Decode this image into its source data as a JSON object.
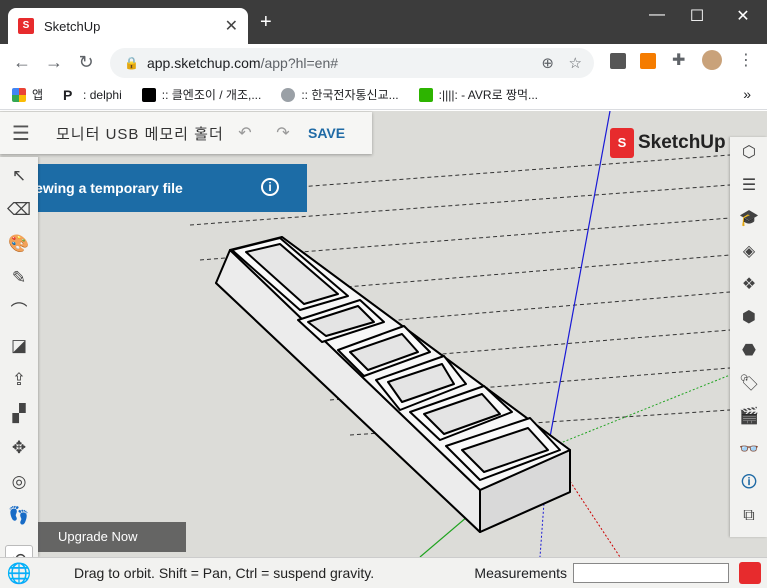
{
  "browser": {
    "tab_title": "SketchUp",
    "tab_close": "✕",
    "new_tab": "+",
    "url_host": "app.sketchup.com",
    "url_path": "/app?hl=en#",
    "window_controls": [
      "—",
      "☐",
      "✕"
    ]
  },
  "bookmarks": [
    {
      "label": "앱",
      "icon": "apps-grid-icon",
      "color": "#ea4335"
    },
    {
      "label": ": delphi",
      "icon": "p-logo-icon",
      "color": "#000000"
    },
    {
      "label": ":: 클엔조이 / 개조,...",
      "icon": "clien-icon",
      "color": "#000000"
    },
    {
      "label": ":: 한국전자통신교...",
      "icon": "globe-icon",
      "color": "#5f6368"
    },
    {
      "label": ":||||: - AVR로 짱먹...",
      "icon": "chat-icon",
      "color": "#2db400"
    }
  ],
  "bookmarks_more": "»",
  "header": {
    "menu_icon": "hamburger-icon",
    "file_name": "모니터 USB 메모리 홀더",
    "undo": "↶",
    "redo": "↷",
    "save_label": "SAVE"
  },
  "banner": {
    "text": "u are viewing a temporary file",
    "info": "i"
  },
  "logo": {
    "mark": "S",
    "name": "SketchUp"
  },
  "left_tools": [
    {
      "name": "select-tool-icon",
      "glyph": "↖",
      "selected": false
    },
    {
      "name": "eraser-tool-icon",
      "glyph": "⌫",
      "selected": false
    },
    {
      "name": "paint-bucket-tool-icon",
      "glyph": "🎨",
      "selected": false
    },
    {
      "name": "line-tool-icon",
      "glyph": "✎",
      "selected": false
    },
    {
      "name": "arc-tool-icon",
      "glyph": "⌒",
      "selected": false
    },
    {
      "name": "rectangle-tool-icon",
      "glyph": "◪",
      "selected": false
    },
    {
      "name": "push-pull-tool-icon",
      "glyph": "⇪",
      "selected": false
    },
    {
      "name": "offset-tool-icon",
      "glyph": "▞",
      "selected": false
    },
    {
      "name": "move-tool-icon",
      "glyph": "✥",
      "selected": false
    },
    {
      "name": "tape-measure-tool-icon",
      "glyph": "◎",
      "selected": false
    },
    {
      "name": "walk-tool-icon",
      "glyph": "👣",
      "selected": false
    },
    {
      "name": "orbit-tool-icon",
      "glyph": "⟲",
      "selected": true
    }
  ],
  "right_tools": [
    {
      "name": "entity-info-icon",
      "glyph": "⬡"
    },
    {
      "name": "outliner-icon",
      "glyph": "☰"
    },
    {
      "name": "instructor-icon",
      "glyph": "🎓"
    },
    {
      "name": "materials-icon",
      "glyph": "◈"
    },
    {
      "name": "components-icon",
      "glyph": "❖"
    },
    {
      "name": "solid-tools-icon",
      "glyph": "⬢"
    },
    {
      "name": "styles-icon",
      "glyph": "⬣"
    },
    {
      "name": "tags-icon",
      "glyph": "🏷"
    },
    {
      "name": "scenes-icon",
      "glyph": "🎬"
    },
    {
      "name": "display-icon",
      "glyph": "👓"
    },
    {
      "name": "model-info-icon",
      "glyph": "🛈"
    },
    {
      "name": "extensions-icon",
      "glyph": "⧉"
    }
  ],
  "upgrade_label": "Upgrade Now",
  "status": {
    "hint": "Drag to orbit. Shift = Pan, Ctrl = suspend gravity.",
    "measurements_label": "Measurements",
    "measurements_value": ""
  },
  "colors": {
    "accent": "#1f6aa5",
    "brand": "#e72b2d",
    "viewport": "#dcdcd8",
    "axis_blue": "#1a1ad6",
    "axis_green": "#1fa31f"
  }
}
